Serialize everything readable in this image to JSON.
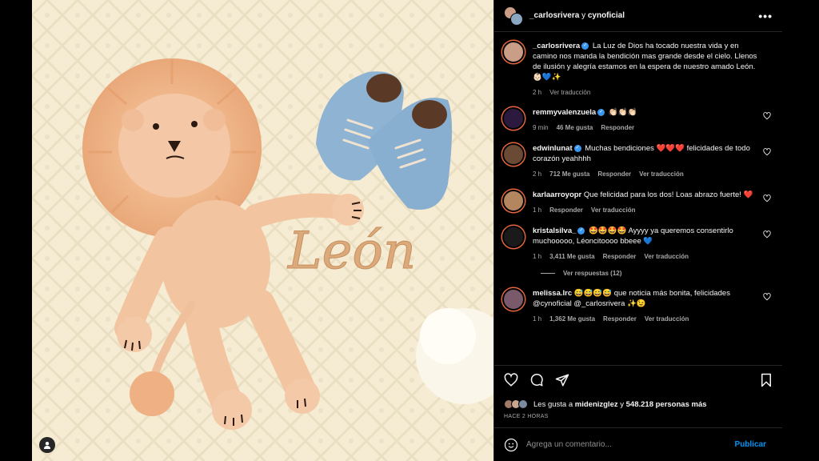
{
  "header": {
    "user1": "_carlosrivera",
    "joiner": "y",
    "user2": "cynoficial"
  },
  "caption": {
    "username": "_carlosrivera",
    "text": "La Luz de Dios ha tocado nuestra vida y en camino nos manda la bendición mas grande desde el cielo. Llenos de ilusión y alegría estamos en la espera de nuestro amado León. 👶🏻💙✨",
    "time": "2 h",
    "translate": "Ver traducción"
  },
  "comments": [
    {
      "username": "remmyvalenzuela",
      "verified": true,
      "text": "👏🏻👏🏻👏🏻",
      "time": "9 min",
      "likes": "46 Me gusta",
      "reply": "Responder",
      "translate": "",
      "avatar_color": "#2b1a3d"
    },
    {
      "username": "edwinlunat",
      "verified": true,
      "text": "Muchas bendiciones ❤️❤️❤️ felicidades de todo corazón yeahhhh",
      "time": "2 h",
      "likes": "712 Me gusta",
      "reply": "Responder",
      "translate": "Ver traducción",
      "avatar_color": "#6b4a35"
    },
    {
      "username": "karlaarroyopr",
      "verified": false,
      "text": "Que felicidad para los dos! Loas abrazo fuerte! ❤️",
      "time": "1 h",
      "likes": "",
      "reply": "Responder",
      "translate": "Ver traducción",
      "avatar_color": "#b38660"
    },
    {
      "username": "kristalsilva_",
      "verified": true,
      "text": "🤩🤩🤩🤩 Ayyyy ya queremos consentirlo muchooooo, Léoncitoooo bbeee 💙",
      "time": "1 h",
      "likes": "3,411 Me gusta",
      "reply": "Responder",
      "translate": "Ver traducción",
      "avatar_color": "#1a1a1a"
    },
    {
      "username": "melissa.lrc",
      "verified": false,
      "text": "😅😅😅😅 que noticia más bonita, felicidades @cynoficial @_carlosrivera ✨😉",
      "time": "1 h",
      "likes": "1,362 Me gusta",
      "reply": "Responder",
      "translate": "Ver traducción",
      "avatar_color": "#7a5a6a"
    }
  ],
  "view_replies": "Ver respuestas (12)",
  "likes": {
    "prefix": "Les gusta a",
    "user": "midenizglez",
    "joiner": "y",
    "count": "548.218 personas más"
  },
  "timestamp": "HACE 2 HORAS",
  "add_comment": {
    "placeholder": "Agrega un comentario...",
    "publish": "Publicar"
  },
  "photo": {
    "embroidery": "León"
  },
  "colors": {
    "accent": "#0095f6",
    "verified": "#3897f0",
    "background": "#000000"
  }
}
